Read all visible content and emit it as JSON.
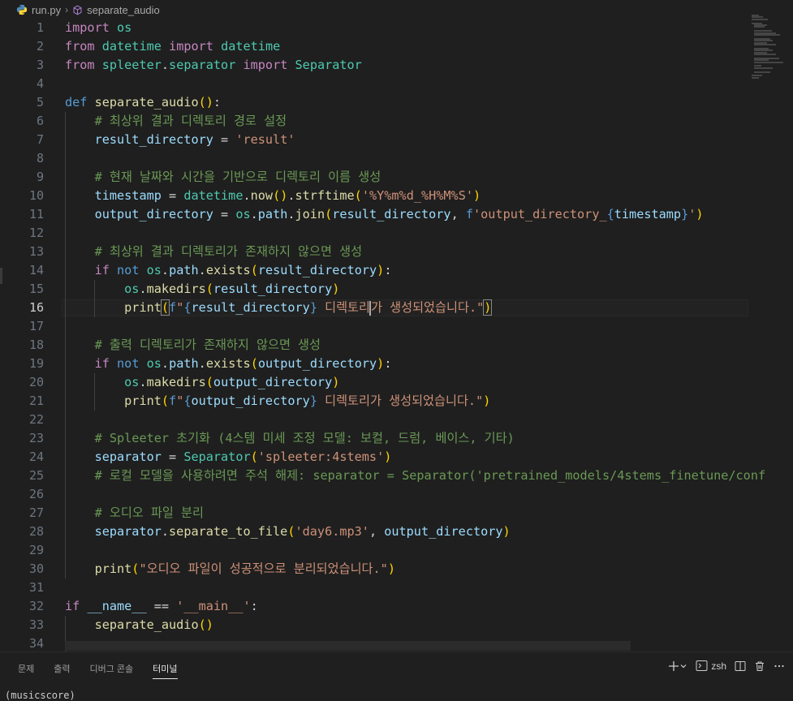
{
  "breadcrumb": {
    "file": "run.py",
    "symbol": "separate_audio",
    "file_icon": "python-icon",
    "symbol_icon": "cube-icon"
  },
  "editor": {
    "active_line": 16,
    "lines": [
      {
        "n": "1",
        "tokens": [
          [
            "k",
            "import"
          ],
          [
            "o",
            " "
          ],
          [
            "c",
            "os"
          ]
        ]
      },
      {
        "n": "2",
        "tokens": [
          [
            "k",
            "from"
          ],
          [
            "o",
            " "
          ],
          [
            "c",
            "datetime"
          ],
          [
            "o",
            " "
          ],
          [
            "k",
            "import"
          ],
          [
            "o",
            " "
          ],
          [
            "c",
            "datetime"
          ]
        ]
      },
      {
        "n": "3",
        "tokens": [
          [
            "k",
            "from"
          ],
          [
            "o",
            " "
          ],
          [
            "c",
            "spleeter"
          ],
          [
            "o",
            "."
          ],
          [
            "c",
            "separator"
          ],
          [
            "o",
            " "
          ],
          [
            "k",
            "import"
          ],
          [
            "o",
            " "
          ],
          [
            "c",
            "Separator"
          ]
        ]
      },
      {
        "n": "4",
        "tokens": []
      },
      {
        "n": "5",
        "tokens": [
          [
            "d",
            "def"
          ],
          [
            "o",
            " "
          ],
          [
            "f",
            "separate_audio"
          ],
          [
            "b1",
            "()"
          ],
          [
            "o",
            ":"
          ]
        ]
      },
      {
        "n": "6",
        "tokens": [
          [
            "o",
            "    "
          ],
          [
            "cm",
            "# 최상위 결과 디렉토리 경로 설정"
          ]
        ]
      },
      {
        "n": "7",
        "tokens": [
          [
            "o",
            "    "
          ],
          [
            "v",
            "result_directory"
          ],
          [
            "o",
            " = "
          ],
          [
            "s",
            "'result'"
          ]
        ]
      },
      {
        "n": "8",
        "tokens": []
      },
      {
        "n": "9",
        "tokens": [
          [
            "o",
            "    "
          ],
          [
            "cm",
            "# 현재 날짜와 시간을 기반으로 디렉토리 이름 생성"
          ]
        ]
      },
      {
        "n": "10",
        "tokens": [
          [
            "o",
            "    "
          ],
          [
            "v",
            "timestamp"
          ],
          [
            "o",
            " = "
          ],
          [
            "c",
            "datetime"
          ],
          [
            "o",
            "."
          ],
          [
            "f",
            "now"
          ],
          [
            "b1",
            "()"
          ],
          [
            "o",
            "."
          ],
          [
            "f",
            "strftime"
          ],
          [
            "b1",
            "("
          ],
          [
            "s",
            "'%Y%m%d_%H%M%S'"
          ],
          [
            "b1",
            ")"
          ]
        ]
      },
      {
        "n": "11",
        "tokens": [
          [
            "o",
            "    "
          ],
          [
            "v",
            "output_directory"
          ],
          [
            "o",
            " = "
          ],
          [
            "c",
            "os"
          ],
          [
            "o",
            "."
          ],
          [
            "v",
            "path"
          ],
          [
            "o",
            "."
          ],
          [
            "f",
            "join"
          ],
          [
            "b1",
            "("
          ],
          [
            "v",
            "result_directory"
          ],
          [
            "o",
            ", "
          ],
          [
            "d",
            "f"
          ],
          [
            "s",
            "'output_directory_"
          ],
          [
            "d",
            "{"
          ],
          [
            "v",
            "timestamp"
          ],
          [
            "d",
            "}"
          ],
          [
            "s",
            "'"
          ],
          [
            "b1",
            ")"
          ]
        ]
      },
      {
        "n": "12",
        "tokens": []
      },
      {
        "n": "13",
        "tokens": [
          [
            "o",
            "    "
          ],
          [
            "cm",
            "# 최상위 결과 디렉토리가 존재하지 않으면 생성"
          ]
        ]
      },
      {
        "n": "14",
        "tokens": [
          [
            "o",
            "    "
          ],
          [
            "k",
            "if"
          ],
          [
            "o",
            " "
          ],
          [
            "d",
            "not"
          ],
          [
            "o",
            " "
          ],
          [
            "c",
            "os"
          ],
          [
            "o",
            "."
          ],
          [
            "v",
            "path"
          ],
          [
            "o",
            "."
          ],
          [
            "f",
            "exists"
          ],
          [
            "b1",
            "("
          ],
          [
            "v",
            "result_directory"
          ],
          [
            "b1",
            ")"
          ],
          [
            "o",
            ":"
          ]
        ]
      },
      {
        "n": "15",
        "tokens": [
          [
            "o",
            "        "
          ],
          [
            "c",
            "os"
          ],
          [
            "o",
            "."
          ],
          [
            "f",
            "makedirs"
          ],
          [
            "b1",
            "("
          ],
          [
            "v",
            "result_directory"
          ],
          [
            "b1",
            ")"
          ]
        ]
      },
      {
        "n": "16",
        "tokens": [
          [
            "o",
            "        "
          ],
          [
            "f",
            "print"
          ],
          [
            "b1bm",
            "("
          ],
          [
            "d",
            "f"
          ],
          [
            "s",
            "\""
          ],
          [
            "d",
            "{"
          ],
          [
            "v",
            "result_directory"
          ],
          [
            "d",
            "}"
          ],
          [
            "s",
            " 디렉토리"
          ],
          [
            "caret",
            ""
          ],
          [
            "s",
            "가 생성되었습니다.\""
          ],
          [
            "b1bm",
            ")"
          ]
        ]
      },
      {
        "n": "17",
        "tokens": []
      },
      {
        "n": "18",
        "tokens": [
          [
            "o",
            "    "
          ],
          [
            "cm",
            "# 출력 디렉토리가 존재하지 않으면 생성"
          ]
        ]
      },
      {
        "n": "19",
        "tokens": [
          [
            "o",
            "    "
          ],
          [
            "k",
            "if"
          ],
          [
            "o",
            " "
          ],
          [
            "d",
            "not"
          ],
          [
            "o",
            " "
          ],
          [
            "c",
            "os"
          ],
          [
            "o",
            "."
          ],
          [
            "v",
            "path"
          ],
          [
            "o",
            "."
          ],
          [
            "f",
            "exists"
          ],
          [
            "b1",
            "("
          ],
          [
            "v",
            "output_directory"
          ],
          [
            "b1",
            ")"
          ],
          [
            "o",
            ":"
          ]
        ]
      },
      {
        "n": "20",
        "tokens": [
          [
            "o",
            "        "
          ],
          [
            "c",
            "os"
          ],
          [
            "o",
            "."
          ],
          [
            "f",
            "makedirs"
          ],
          [
            "b1",
            "("
          ],
          [
            "v",
            "output_directory"
          ],
          [
            "b1",
            ")"
          ]
        ]
      },
      {
        "n": "21",
        "tokens": [
          [
            "o",
            "        "
          ],
          [
            "f",
            "print"
          ],
          [
            "b1",
            "("
          ],
          [
            "d",
            "f"
          ],
          [
            "s",
            "\""
          ],
          [
            "d",
            "{"
          ],
          [
            "v",
            "output_directory"
          ],
          [
            "d",
            "}"
          ],
          [
            "s",
            " 디렉토리가 생성되었습니다.\""
          ],
          [
            "b1",
            ")"
          ]
        ]
      },
      {
        "n": "22",
        "tokens": []
      },
      {
        "n": "23",
        "tokens": [
          [
            "o",
            "    "
          ],
          [
            "cm",
            "# Spleeter 초기화 (4스템 미세 조정 모델: 보컬, 드럼, 베이스, 기타)"
          ]
        ]
      },
      {
        "n": "24",
        "tokens": [
          [
            "o",
            "    "
          ],
          [
            "v",
            "separator"
          ],
          [
            "o",
            " = "
          ],
          [
            "c",
            "Separator"
          ],
          [
            "b1",
            "("
          ],
          [
            "s",
            "'spleeter:4stems'"
          ],
          [
            "b1",
            ")"
          ]
        ]
      },
      {
        "n": "25",
        "tokens": [
          [
            "o",
            "    "
          ],
          [
            "cm",
            "# 로컬 모델을 사용하려면 주석 해제: separator = Separator('pretrained_models/4stems_finetune/conf"
          ]
        ]
      },
      {
        "n": "26",
        "tokens": []
      },
      {
        "n": "27",
        "tokens": [
          [
            "o",
            "    "
          ],
          [
            "cm",
            "# 오디오 파일 분리"
          ]
        ]
      },
      {
        "n": "28",
        "tokens": [
          [
            "o",
            "    "
          ],
          [
            "v",
            "separator"
          ],
          [
            "o",
            "."
          ],
          [
            "f",
            "separate_to_file"
          ],
          [
            "b1",
            "("
          ],
          [
            "s",
            "'day6.mp3'"
          ],
          [
            "o",
            ", "
          ],
          [
            "v",
            "output_directory"
          ],
          [
            "b1",
            ")"
          ]
        ]
      },
      {
        "n": "29",
        "tokens": []
      },
      {
        "n": "30",
        "tokens": [
          [
            "o",
            "    "
          ],
          [
            "f",
            "print"
          ],
          [
            "b1",
            "("
          ],
          [
            "s",
            "\"오디오 파일이 성공적으로 분리되었습니다.\""
          ],
          [
            "b1",
            ")"
          ]
        ]
      },
      {
        "n": "31",
        "tokens": []
      },
      {
        "n": "32",
        "tokens": [
          [
            "k",
            "if"
          ],
          [
            "o",
            " "
          ],
          [
            "v",
            "__name__"
          ],
          [
            "o",
            " == "
          ],
          [
            "s",
            "'__main__'"
          ],
          [
            "o",
            ":"
          ]
        ]
      },
      {
        "n": "33",
        "tokens": [
          [
            "o",
            "    "
          ],
          [
            "f",
            "separate_audio"
          ],
          [
            "b1",
            "()"
          ]
        ]
      },
      {
        "n": "34",
        "tokens": []
      }
    ]
  },
  "panel": {
    "tabs": [
      "문제",
      "출력",
      "디버그 콘솔",
      "터미널"
    ],
    "active_tab": "터미널",
    "terminal_label": "zsh",
    "terminal_first_line": "(musicscore)"
  },
  "colors": {
    "background": "#1f1f1f",
    "keyword": "#c586c0",
    "storage": "#569cd6",
    "function": "#dcdcaa",
    "class": "#4ec9b0",
    "variable": "#9cdcfe",
    "string": "#ce9178",
    "comment": "#6a9955",
    "bracket": "#ffd700"
  }
}
